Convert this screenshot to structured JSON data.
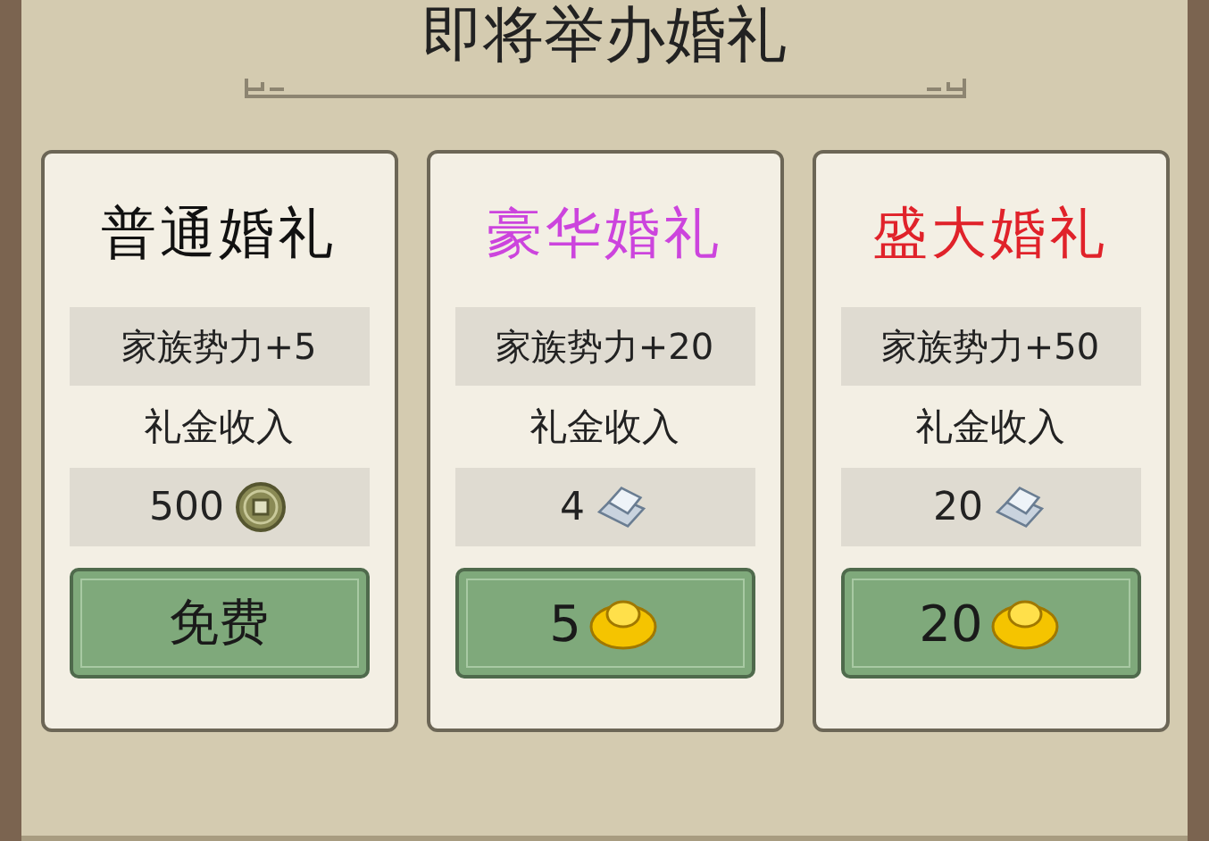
{
  "title": "即将举办婚礼",
  "options": [
    {
      "name": "普通婚礼",
      "color": "#111111",
      "bonus": "家族势力+5",
      "income_label": "礼金收入",
      "income": "500",
      "income_icon": {
        "kind": "coin"
      },
      "cost": "免费"
    },
    {
      "name": "豪华婚礼",
      "color": "#cc44dd",
      "bonus": "家族势力+20",
      "income_label": "礼金收入",
      "income": "4",
      "income_icon": {
        "kind": "bar"
      },
      "cost": "5",
      "cost_icon": {
        "kind": "ingot"
      }
    },
    {
      "name": "盛大婚礼",
      "color": "#e0222a",
      "bonus": "家族势力+50",
      "income_label": "礼金收入",
      "income": "20",
      "income_icon": {
        "kind": "bar"
      },
      "cost": "20",
      "cost_icon": {
        "kind": "ingot"
      }
    }
  ]
}
